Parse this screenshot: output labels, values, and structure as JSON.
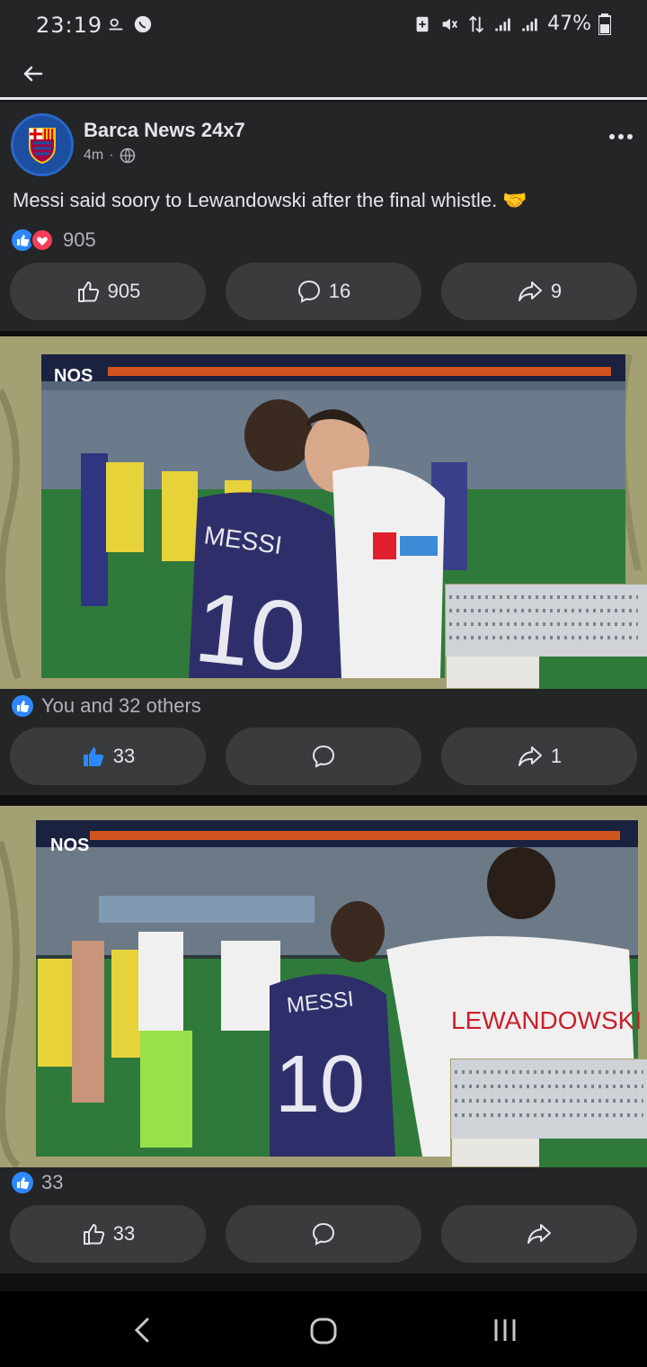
{
  "status": {
    "time": "23:19",
    "battery": "47%"
  },
  "post": {
    "page_name": "Barca News 24x7",
    "time_ago": "4m",
    "text": "Messi said soory to Lewandowski after the final whistle. 🤝",
    "reaction_count": "905",
    "like_count": "905",
    "comment_count": "16",
    "share_count": "9"
  },
  "photo1": {
    "summary": "You and 32 others",
    "like_count": "33",
    "share_count": "1",
    "watermark": "NOS",
    "jersey_name": "MESSI",
    "jersey_number": "10"
  },
  "photo2": {
    "summary": "33",
    "like_count": "33",
    "watermark": "NOS",
    "jersey_name": "MESSI",
    "jersey_number": "10",
    "back_name": "LEWANDOWSKI"
  },
  "colors": {
    "bg": "#18191a",
    "card": "#242526",
    "pill": "#3a3b3c",
    "like_blue": "#2d88ff",
    "love_red": "#f33e58"
  }
}
